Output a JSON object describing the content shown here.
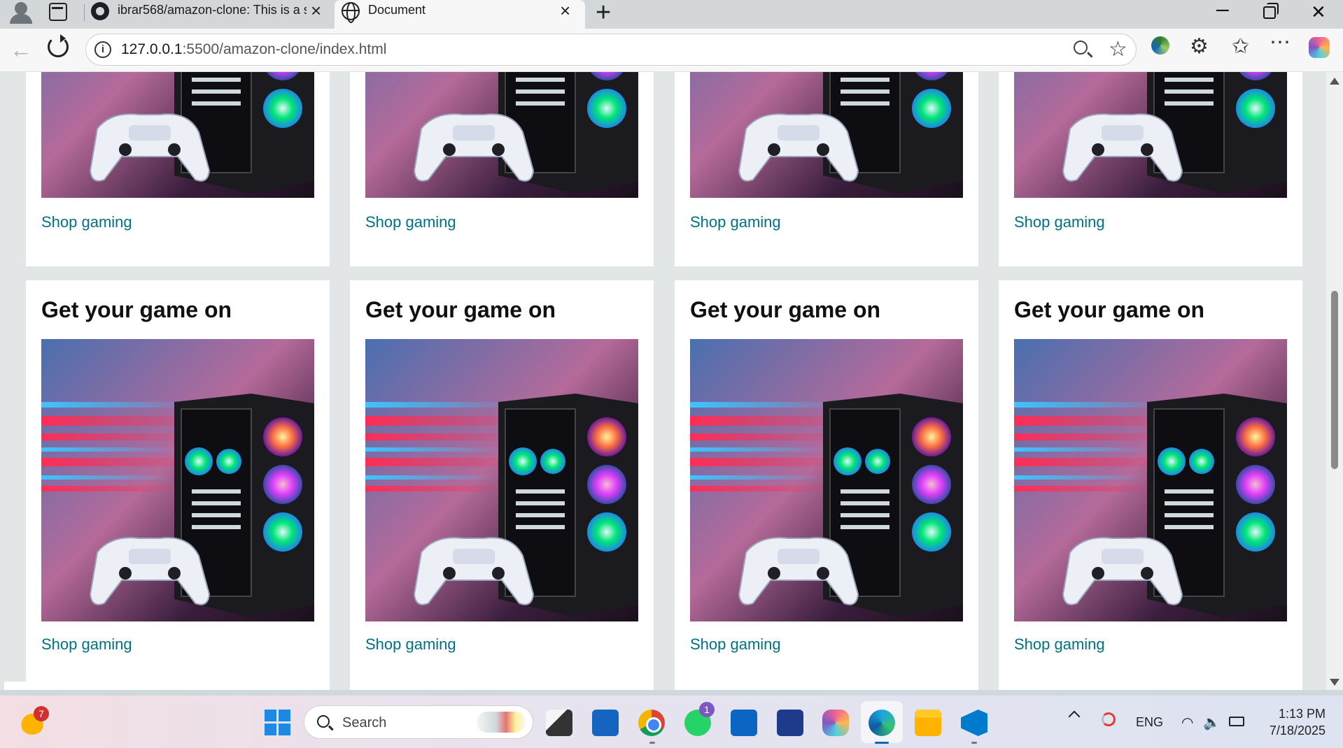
{
  "browser": {
    "tabs": [
      {
        "title": "ibrar568/amazon-clone: This is a s",
        "icon": "github-icon",
        "active": false
      },
      {
        "title": "Document",
        "icon": "globe-icon",
        "active": true
      }
    ],
    "new_tab_label": "+",
    "window_controls": {
      "minimize": "–",
      "close": "✕"
    },
    "url": {
      "host": "127.0.0.1",
      "path": ":5500/amazon-clone/index.html"
    },
    "toolbar_icons": [
      "zoom-out-icon",
      "favorite-star-icon",
      "extension-globe-icon",
      "extensions-puzzle-icon",
      "favorites-icon",
      "more-icon",
      "copilot-icon"
    ]
  },
  "page": {
    "row1_cards": [
      {
        "link": "Shop gaming"
      },
      {
        "link": "Shop gaming"
      },
      {
        "link": "Shop gaming"
      },
      {
        "link": "Shop gaming"
      }
    ],
    "row2_cards": [
      {
        "title": "Get your game on",
        "link": "Shop gaming"
      },
      {
        "title": "Get your game on",
        "link": "Shop gaming"
      },
      {
        "title": "Get your game on",
        "link": "Shop gaming"
      },
      {
        "title": "Get your game on",
        "link": "Shop gaming"
      }
    ]
  },
  "taskbar": {
    "weather_badge": "7",
    "search_label": "Search",
    "whatsapp_badge": "1",
    "tray_language": "ENG",
    "clock_time": "1:13 PM",
    "clock_date": "7/18/2025",
    "apps": [
      "start-icon",
      "file-explorer-icon",
      "mail-icon",
      "chrome-icon",
      "whatsapp-icon",
      "outlook-icon",
      "store-icon",
      "copilot-icon",
      "edge-icon",
      "folder-icon",
      "vscode-icon"
    ]
  },
  "colors": {
    "link": "#007185",
    "title": "#0f1111",
    "page_bg": "#e3e6e6",
    "card_bg": "#ffffff"
  }
}
